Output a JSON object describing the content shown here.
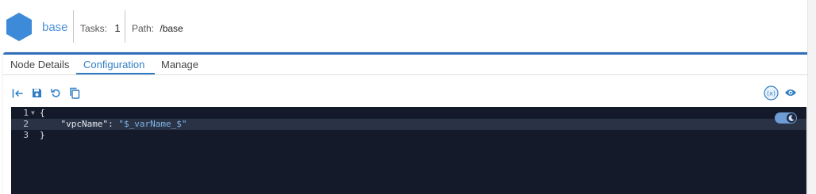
{
  "header": {
    "node_name": "base",
    "tasks_label": "Tasks:",
    "tasks_value": "1",
    "path_label": "Path:",
    "path_value": "/base",
    "hex_color": "#3d8bd8"
  },
  "tabs": [
    {
      "label": "Node Details",
      "active": false
    },
    {
      "label": "Configuration",
      "active": true
    },
    {
      "label": "Manage",
      "active": false
    }
  ],
  "toolbar": {
    "left_icons": [
      "import-icon",
      "save-icon",
      "undo-icon",
      "copy-icon"
    ],
    "right_icons": [
      "variable-icon",
      "eye-icon"
    ]
  },
  "editor": {
    "theme": "dark",
    "toggle_icon": "moon-icon",
    "lines": [
      {
        "number": "1",
        "foldable": true,
        "text": "{"
      },
      {
        "number": "2",
        "foldable": false,
        "key": "\"vpcName\"",
        "sep": ": ",
        "value": "\"$_varName_$\"",
        "indent": "    "
      },
      {
        "number": "3",
        "foldable": false,
        "text": "}"
      }
    ]
  },
  "colors": {
    "accent": "#2f7dc4",
    "editor_bg": "#141a29",
    "string": "#7fb4e6"
  }
}
